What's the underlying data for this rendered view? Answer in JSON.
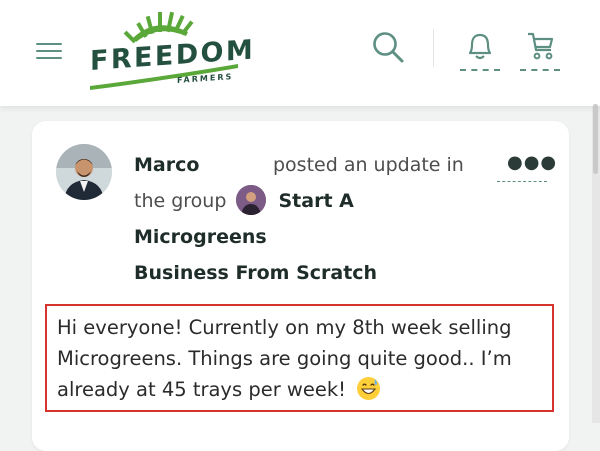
{
  "header": {
    "logo_main": "FREEDOM",
    "logo_sub": "FARMERS",
    "menu_icon": "hamburger-icon",
    "search_icon": "search-icon",
    "bell_icon": "bell-icon",
    "cart_icon": "cart-icon"
  },
  "post": {
    "author": "Marco",
    "action_text": "posted an update in",
    "group_prefix": "the group",
    "group_name_line1": "Start A Microgreens",
    "group_name_line2": "Business From Scratch",
    "more_icon": "more-options-icon",
    "body": "Hi everyone! Currently on my 8th week selling Microgreens. Things are going quite good.. I’m already at 45 trays per week!",
    "emoji": "grinning-sweat-emoji"
  },
  "colors": {
    "brand_dark": "#24503f",
    "brand_green": "#5aa83a",
    "icon_teal": "#5d8f83",
    "highlight_border": "#d6322e"
  }
}
